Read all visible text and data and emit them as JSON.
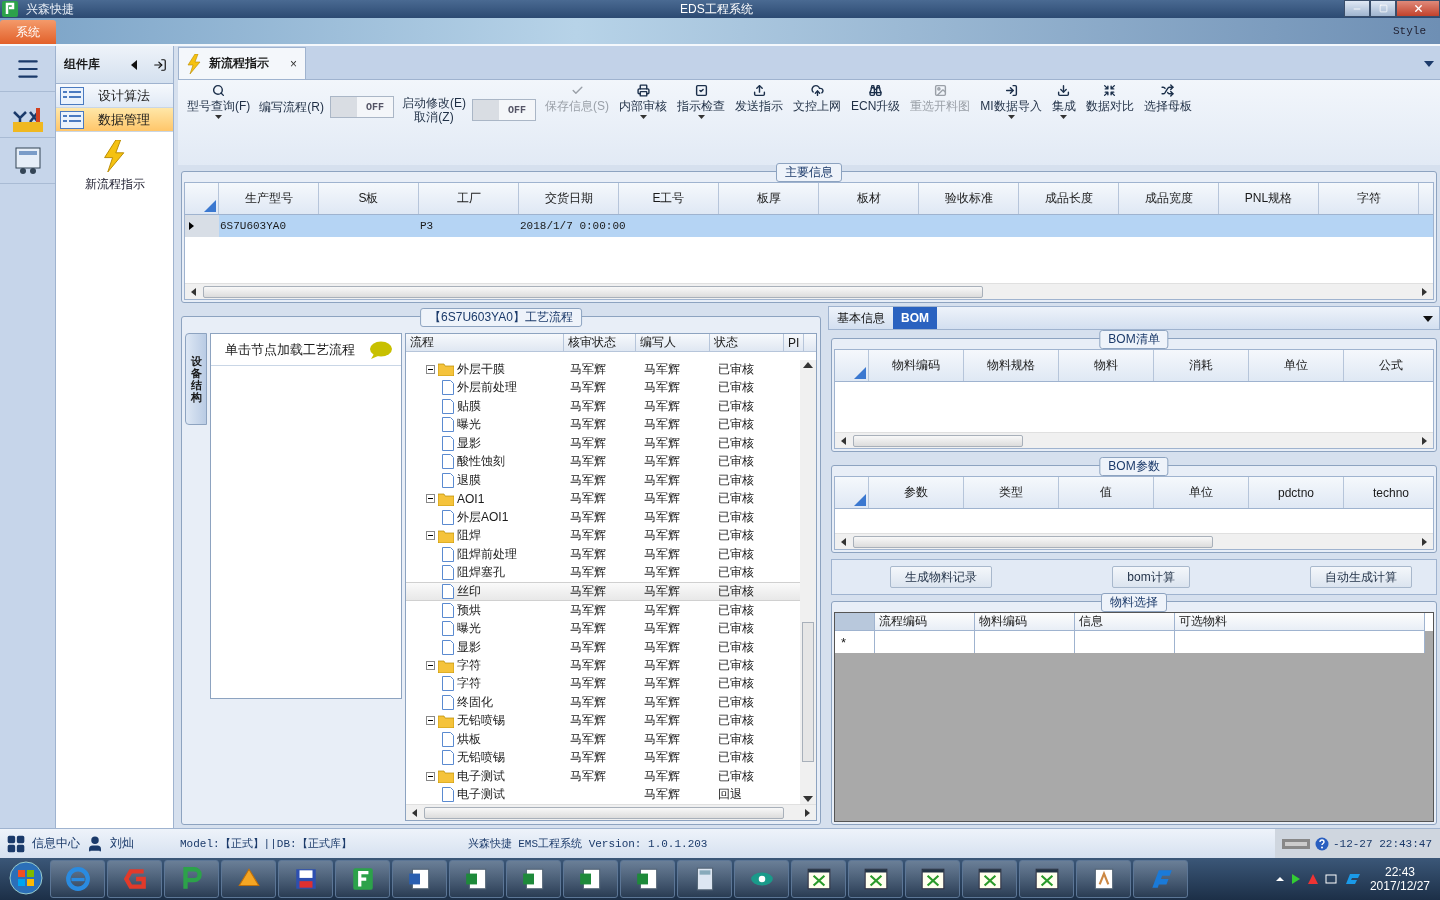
{
  "title_bar": {
    "app_name": "兴森快捷",
    "title": "EDS工程系统"
  },
  "ribbon": {
    "tabs": [
      {
        "label": "系统",
        "selected": true
      }
    ],
    "style_label": "Style"
  },
  "nav_panel": {
    "title": "组件库",
    "items": [
      {
        "label": "设计算法",
        "selected": false
      },
      {
        "label": "数据管理",
        "selected": true
      }
    ],
    "launch_item": "新流程指示"
  },
  "doc_tab": {
    "label": "新流程指示",
    "close": "×"
  },
  "toolbar": [
    {
      "kind": "button",
      "lines": [
        "型号查询(F)"
      ],
      "disabled": false,
      "dropdown": true
    },
    {
      "kind": "toggle",
      "lines": [
        "编写流程(R)"
      ],
      "on": false,
      "switch_text": "OFF"
    },
    {
      "kind": "toggle",
      "lines": [
        "启动修改(E)",
        "取消(Z)"
      ],
      "on": false,
      "switch_text": "OFF"
    },
    {
      "kind": "button",
      "lines": [
        "保存信息(S)"
      ],
      "disabled": true,
      "dropdown": false
    },
    {
      "kind": "button",
      "lines": [
        "内部审核"
      ],
      "disabled": false,
      "dropdown": true
    },
    {
      "kind": "button",
      "lines": [
        "指示检查"
      ],
      "disabled": false,
      "dropdown": true
    },
    {
      "kind": "button",
      "lines": [
        "发送指示"
      ],
      "disabled": false,
      "dropdown": false
    },
    {
      "kind": "button",
      "lines": [
        "文控上网"
      ],
      "disabled": false,
      "dropdown": false
    },
    {
      "kind": "button",
      "lines": [
        "ECN升级"
      ],
      "disabled": false,
      "dropdown": false
    },
    {
      "kind": "button",
      "lines": [
        "重选开料图"
      ],
      "disabled": true,
      "dropdown": false
    },
    {
      "kind": "button",
      "lines": [
        "MI数据导入"
      ],
      "disabled": false,
      "dropdown": true
    },
    {
      "kind": "button",
      "lines": [
        "集成"
      ],
      "disabled": false,
      "dropdown": true
    },
    {
      "kind": "button",
      "lines": [
        "数据对比"
      ],
      "disabled": false,
      "dropdown": false
    },
    {
      "kind": "button",
      "lines": [
        "选择母板"
      ],
      "disabled": false,
      "dropdown": false
    }
  ],
  "main_info": {
    "title": "主要信息",
    "columns": [
      "生产型号",
      "S板",
      "工厂",
      "交货日期",
      "E工号",
      "板厚",
      "板材",
      "验收标准",
      "成品长度",
      "成品宽度",
      "PNL规格",
      "字符"
    ],
    "rows": [
      {
        "selected": true,
        "cells": [
          "6S7U603YA0",
          null,
          "P3",
          "2018/1/7 0:00:00"
        ]
      }
    ]
  },
  "process": {
    "title": "【6S7U603YA0】工艺流程",
    "side_tab": "设备结构",
    "hint": "单击节点加载工艺流程",
    "columns": [
      "流程",
      "核审状态",
      "编写人",
      "状态",
      "PI"
    ],
    "tree": [
      {
        "name": "外层干膜",
        "review": "马军辉",
        "writer": "马军辉",
        "status": "已审核",
        "selected": false,
        "expanded": true,
        "children": [
          {
            "name": "外层前处理",
            "review": "马军辉",
            "writer": "马军辉",
            "status": "已审核",
            "selected": false
          },
          {
            "name": "贴膜",
            "review": "马军辉",
            "writer": "马军辉",
            "status": "已审核",
            "selected": false
          },
          {
            "name": "曝光",
            "review": "马军辉",
            "writer": "马军辉",
            "status": "已审核",
            "selected": false
          },
          {
            "name": "显影",
            "review": "马军辉",
            "writer": "马军辉",
            "status": "已审核",
            "selected": false
          },
          {
            "name": "酸性蚀刻",
            "review": "马军辉",
            "writer": "马军辉",
            "status": "已审核",
            "selected": false
          },
          {
            "name": "退膜",
            "review": "马军辉",
            "writer": "马军辉",
            "status": "已审核",
            "selected": false
          }
        ]
      },
      {
        "name": "AOI1",
        "review": "马军辉",
        "writer": "马军辉",
        "status": "已审核",
        "selected": false,
        "expanded": true,
        "children": [
          {
            "name": "外层AOI1",
            "review": "马军辉",
            "writer": "马军辉",
            "status": "已审核",
            "selected": false
          }
        ]
      },
      {
        "name": "阻焊",
        "review": "马军辉",
        "writer": "马军辉",
        "status": "已审核",
        "selected": false,
        "expanded": true,
        "children": [
          {
            "name": "阻焊前处理",
            "review": "马军辉",
            "writer": "马军辉",
            "status": "已审核",
            "selected": false
          },
          {
            "name": "阻焊塞孔",
            "review": "马军辉",
            "writer": "马军辉",
            "status": "已审核",
            "selected": false
          },
          {
            "name": "丝印",
            "review": "马军辉",
            "writer": "马军辉",
            "status": "已审核",
            "selected": true
          },
          {
            "name": "预烘",
            "review": "马军辉",
            "writer": "马军辉",
            "status": "已审核",
            "selected": false
          },
          {
            "name": "曝光",
            "review": "马军辉",
            "writer": "马军辉",
            "status": "已审核",
            "selected": false
          },
          {
            "name": "显影",
            "review": "马军辉",
            "writer": "马军辉",
            "status": "已审核",
            "selected": false
          }
        ]
      },
      {
        "name": "字符",
        "review": "马军辉",
        "writer": "马军辉",
        "status": "已审核",
        "selected": false,
        "expanded": true,
        "children": [
          {
            "name": "字符",
            "review": "马军辉",
            "writer": "马军辉",
            "status": "已审核",
            "selected": false
          },
          {
            "name": "终固化",
            "review": "马军辉",
            "writer": "马军辉",
            "status": "已审核",
            "selected": false
          }
        ]
      },
      {
        "name": "无铅喷锡",
        "review": "马军辉",
        "writer": "马军辉",
        "status": "已审核",
        "selected": false,
        "expanded": true,
        "children": [
          {
            "name": "烘板",
            "review": "马军辉",
            "writer": "马军辉",
            "status": "已审核",
            "selected": false
          },
          {
            "name": "无铅喷锡",
            "review": "马军辉",
            "writer": "马军辉",
            "status": "已审核",
            "selected": false
          }
        ]
      },
      {
        "name": "电子测试",
        "review": "马军辉",
        "writer": "马军辉",
        "status": "已审核",
        "selected": false,
        "expanded": true,
        "children": [
          {
            "name": "电子测试",
            "writer": "马军辉",
            "status": "回退",
            "selected": false
          }
        ]
      }
    ]
  },
  "detail": {
    "tabs": [
      {
        "label": "基本信息",
        "selected": false
      },
      {
        "label": "BOM",
        "selected": true
      }
    ],
    "bom_list": {
      "title": "BOM清单",
      "columns": [
        "物料编码",
        "物料规格",
        "物料",
        "消耗",
        "单位",
        "公式"
      ]
    },
    "bom_params": {
      "title": "BOM参数",
      "columns": [
        "参数",
        "类型",
        "值",
        "单位",
        "pdctno",
        "techno"
      ]
    },
    "actions": [
      "生成物料记录",
      "bom计算",
      "自动生成计算"
    ],
    "material_select": {
      "title": "物料选择",
      "columns": [
        "流程编码",
        "物料编码",
        "信息",
        "可选物料"
      ],
      "new_row_mark": "*"
    }
  },
  "status_bar": {
    "info_center": "信息中心",
    "user": "刘灿",
    "model_db": "Model:【正式】||DB:【正式库】",
    "version": "兴森快捷 EMS工程系统 Version: 1.0.1.203",
    "datetime": "-12-27 22:43:47"
  },
  "taskbar": {
    "time": "22:43",
    "date": "2017/12/27"
  }
}
